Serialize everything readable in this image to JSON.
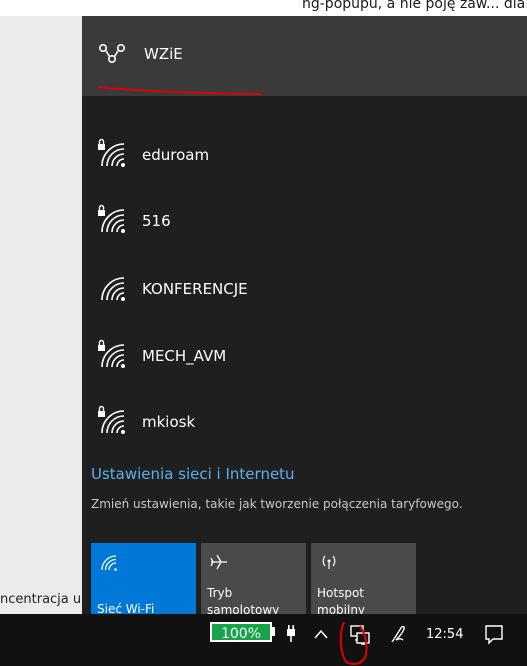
{
  "background_app": {
    "top_text": "ng-popupu, a nie poję zaw... dla...",
    "bottom_text": "ncentracja u"
  },
  "connected": {
    "name": "WZiE",
    "icon": "wired-ethernet-icon"
  },
  "networks": [
    {
      "name": "eduroam",
      "secured": true,
      "icon": "wifi-secured-icon"
    },
    {
      "name": "516",
      "secured": true,
      "icon": "wifi-secured-icon"
    },
    {
      "name": "KONFERENCJE",
      "secured": false,
      "icon": "wifi-icon"
    },
    {
      "name": "MECH_AVM",
      "secured": true,
      "icon": "wifi-secured-icon"
    },
    {
      "name": "mkiosk",
      "secured": true,
      "icon": "wifi-secured-icon"
    }
  ],
  "settings": {
    "link_label": "Ustawienia sieci i Internetu",
    "subtitle": "Zmień ustawienia, takie jak tworzenie połączenia taryfowego."
  },
  "quick_actions": [
    {
      "label": "Sieć Wi-Fi",
      "active": true,
      "icon": "wifi-icon"
    },
    {
      "label_line1": "Tryb",
      "label_line2": "samolotowy",
      "active": false,
      "icon": "airplane-icon"
    },
    {
      "label_line1": "Hotspot",
      "label_line2": "mobilny",
      "active": false,
      "icon": "hotspot-icon"
    }
  ],
  "taskbar": {
    "battery_percent": "100%",
    "clock": "12:54"
  },
  "colors": {
    "accent": "#0078d7",
    "flyout_bg": "#1f1f1f",
    "tile_inactive": "#4a4a4a",
    "link": "#5ab0f0",
    "battery_fill": "#16a34a",
    "annotation_red": "#e00000"
  }
}
